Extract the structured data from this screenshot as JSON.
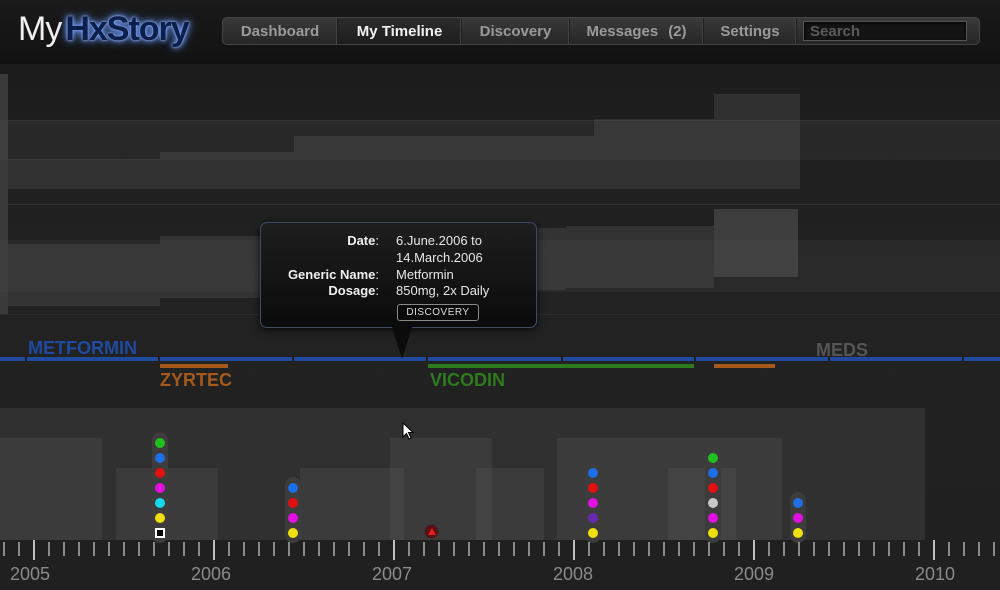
{
  "header": {
    "logo_my": "My",
    "logo_brand": "HxStory"
  },
  "nav": {
    "dashboard": "Dashboard",
    "timeline": "My Timeline",
    "discovery": "Discovery",
    "messages": "Messages",
    "messages_count": "(2)",
    "settings": "Settings",
    "search_placeholder": "Search",
    "active": "My Timeline"
  },
  "meds": {
    "metformin": "METFORMIN",
    "zyrtec": "ZYRTEC",
    "vicodin": "VICODIN",
    "meds_label": "MEDS"
  },
  "tooltip": {
    "date_key": "Date",
    "date_value_1": "6.June.2006  to",
    "date_value_2": "14.March.2006",
    "generic_key": "Generic Name",
    "generic_value": "Metformin",
    "dosage_key": "Dosage",
    "dosage_value": "850mg, 2x Daily",
    "button": "DISCOVERY"
  },
  "colon": ":",
  "years": [
    "2005",
    "2006",
    "2007",
    "2008",
    "2009",
    "2010"
  ],
  "colors": {
    "metformin": "#1f4aa0",
    "zyrtec": "#a55a1c",
    "vicodin": "#2e7a1e"
  },
  "icons": {
    "alert": "red-triangle-alert-icon",
    "cursor": "arrow-cursor-icon"
  }
}
